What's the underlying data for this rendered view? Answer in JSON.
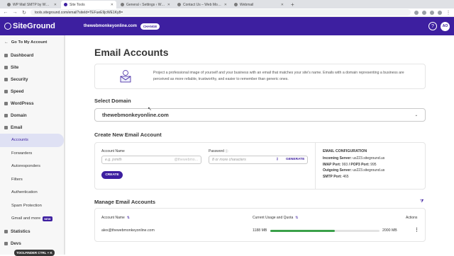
{
  "browser": {
    "tabs": [
      {
        "title": "WP Mail SMTP by WPForms – "
      },
      {
        "title": "Site Tools"
      },
      {
        "title": "General ‹ Settings ‹ Web Monkey"
      },
      {
        "title": "Contact Us – Web Monkey"
      },
      {
        "title": "Webmail"
      }
    ],
    "url": "tools.siteground.com/email?siteId=TEFueE9jcWE1Ky8="
  },
  "header": {
    "logo": "SiteGround",
    "site_name": "thewebmonkeyonline.com",
    "change_label": "CHANGE",
    "help_icon": "question-icon",
    "avatar_initials": "AO",
    "brand_color": "#3d1fa0"
  },
  "sidebar": {
    "back_label": "Go To My Account",
    "items": [
      {
        "label": "Dashboard"
      },
      {
        "label": "Site"
      },
      {
        "label": "Security"
      },
      {
        "label": "Speed"
      },
      {
        "label": "WordPress"
      },
      {
        "label": "Domain"
      },
      {
        "label": "Email"
      }
    ],
    "email_sub": [
      {
        "label": "Accounts"
      },
      {
        "label": "Forwarders"
      },
      {
        "label": "Autoresponders"
      },
      {
        "label": "Filters"
      },
      {
        "label": "Authentication"
      },
      {
        "label": "Spam Protection"
      },
      {
        "label": "Gmail and more"
      }
    ],
    "new_badge": "NEW",
    "bottom_items": [
      {
        "label": "Statistics"
      },
      {
        "label": "Devs"
      }
    ],
    "toolfinder": "TOOLFINDER CTRL + K"
  },
  "main": {
    "title": "Email Accounts",
    "intro": "Project a professional image of yourself and your business with an email that matches your site's name. Emails with a domain representing a business are perceived as more reliable, trustworthy, and easier to remember than generic ones.",
    "select_domain_title": "Select Domain",
    "selected_domain": "thewebmonkeyonline.com",
    "create_title": "Create New Email Account",
    "account_name_label": "Account Name",
    "account_name_placeholder": "e.g. jsmith",
    "account_suffix": "@thewebmo...",
    "password_label": "Password",
    "password_placeholder": "8 or more characters",
    "generate_label": "GENERATE",
    "create_button": "CREATE",
    "config": {
      "title": "EMAIL CONFIGURATION",
      "incoming_label": "Incoming Server:",
      "incoming_value": "us223.siteground.us",
      "imap_label": "IMAP Port:",
      "imap_value": "993",
      "pop3_label": "/ POP3 Port:",
      "pop3_value": "995",
      "outgoing_label": "Outgoing Server:",
      "outgoing_value": "us223.siteground.us",
      "smtp_label": "SMTP Port:",
      "smtp_value": "465"
    },
    "manage_title": "Manage Email Accounts",
    "table": {
      "col_account": "Account Name",
      "col_usage": "Current Usage and Quota",
      "col_actions": "Actions",
      "rows": [
        {
          "account": "alex@thewebmonkeyonline.com",
          "used": "1188 MB",
          "quota": "2000 MB",
          "usage_fraction": 0.594
        }
      ]
    }
  }
}
